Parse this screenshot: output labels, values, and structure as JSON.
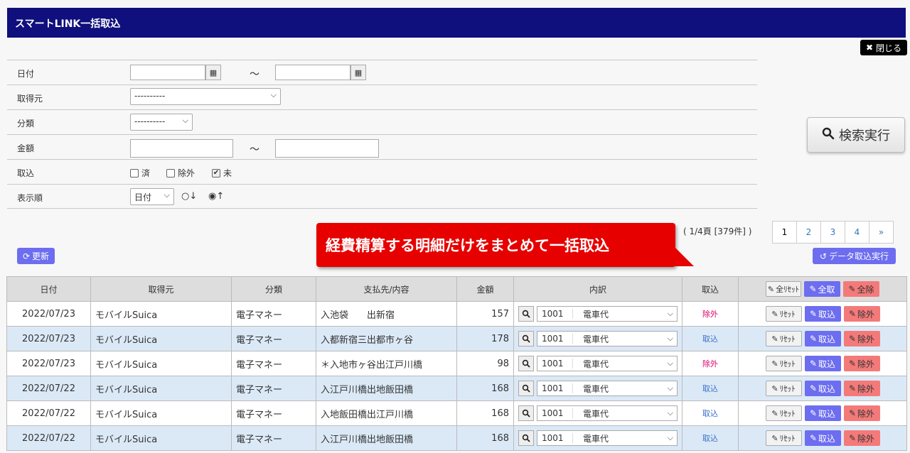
{
  "window": {
    "title": "スマートLINK一括取込",
    "close_label": "閉じる"
  },
  "search": {
    "date_label": "日付",
    "date_from": "",
    "date_to": "",
    "tilde": "～",
    "source_label": "取得元",
    "source_value": "----------",
    "category_label": "分類",
    "category_value": "----------",
    "amount_label": "金額",
    "amount_from": "",
    "amount_to": "",
    "import_label": "取込",
    "import_opts": [
      {
        "label": "済",
        "checked": false
      },
      {
        "label": "除外",
        "checked": false
      },
      {
        "label": "未",
        "checked": true
      }
    ],
    "order_label": "表示順",
    "order_field": "日付",
    "order_desc": "○↓",
    "order_asc": "◉↑",
    "submit_label": "検索実行"
  },
  "toolbar": {
    "refresh_label": "更新",
    "page_info": "( 1/4頁 [379件] )",
    "pages": [
      "1",
      "2",
      "3",
      "4",
      "»"
    ],
    "data_import_label": "データ取込実行"
  },
  "callout": {
    "text": "経費精算する明細だけをまとめて一括取込"
  },
  "table": {
    "headers": [
      "日付",
      "取得元",
      "分類",
      "支払先/内容",
      "金額",
      "内訳",
      "取込"
    ],
    "header_actions": {
      "reset_all": "全ﾘｾｯﾄ",
      "take_all": "全取",
      "exclude_all": "全除"
    },
    "row_actions": {
      "reset": "ﾘｾｯﾄ",
      "take": "取込",
      "exclude": "除外"
    },
    "rows": [
      {
        "date": "2022/07/23",
        "source": "モバイルSuica",
        "category": "電子マネー",
        "payee": "入池袋　　出新宿",
        "amount": "157",
        "code": "1001",
        "item": "電車代",
        "status": "除外"
      },
      {
        "date": "2022/07/23",
        "source": "モバイルSuica",
        "category": "電子マネー",
        "payee": "入都新宿三出都市ヶ谷",
        "amount": "178",
        "code": "1001",
        "item": "電車代",
        "status": "取込"
      },
      {
        "date": "2022/07/23",
        "source": "モバイルSuica",
        "category": "電子マネー",
        "payee": "＊入地市ヶ谷出江戸川橋",
        "amount": "98",
        "code": "1001",
        "item": "電車代",
        "status": "除外"
      },
      {
        "date": "2022/07/22",
        "source": "モバイルSuica",
        "category": "電子マネー",
        "payee": "入江戸川橋出地飯田橋",
        "amount": "168",
        "code": "1001",
        "item": "電車代",
        "status": "取込"
      },
      {
        "date": "2022/07/22",
        "source": "モバイルSuica",
        "category": "電子マネー",
        "payee": "入地飯田橋出江戸川橋",
        "amount": "168",
        "code": "1001",
        "item": "電車代",
        "status": "取込"
      },
      {
        "date": "2022/07/22",
        "source": "モバイルSuica",
        "category": "電子マネー",
        "payee": "入江戸川橋出地飯田橋",
        "amount": "168",
        "code": "1001",
        "item": "電車代",
        "status": "取込"
      }
    ]
  },
  "colors": {
    "titlebar": "#0f0f7d",
    "accent": "#6d6df0",
    "callout": "#e60000",
    "exclude": "#f47a7a",
    "row_alt": "#dbe9f7"
  }
}
